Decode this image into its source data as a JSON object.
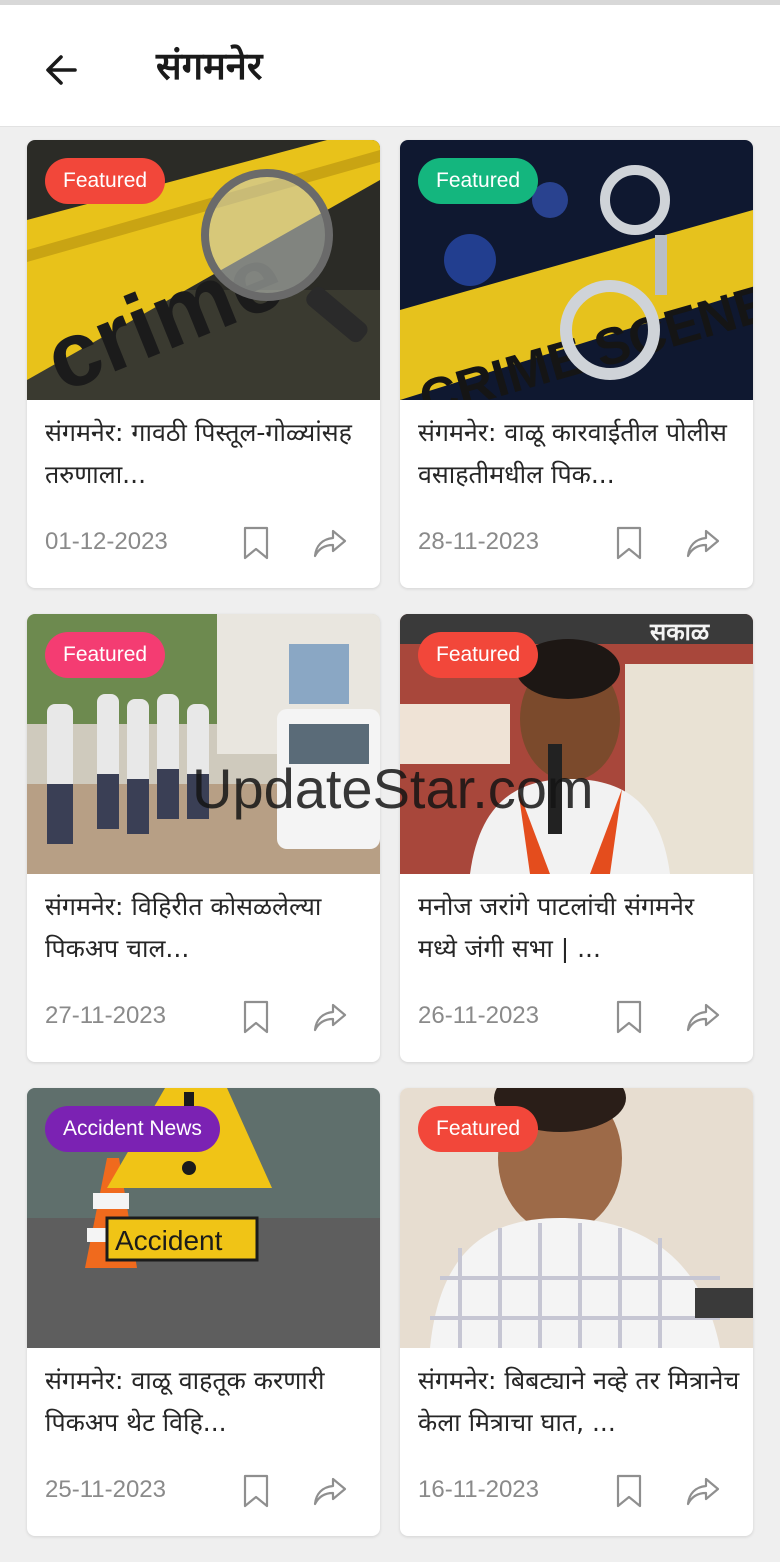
{
  "header": {
    "title": "संगमनेर"
  },
  "badge_colors": {
    "red": "#f2473a",
    "green": "#14b67e",
    "pink": "#f43c72",
    "purple": "#7b22b3"
  },
  "cards": [
    {
      "badge": "Featured",
      "badge_color": "#f2473a",
      "headline": "संगमनेर: गावठी पिस्तूल-गोळ्यांसह तरुणाला...",
      "date": "01-12-2023"
    },
    {
      "badge": "Featured",
      "badge_color": "#14b67e",
      "headline": "संगमनेर: वाळू कारवाईतील पोलीस वसाहतीमधील पिक...",
      "date": "28-11-2023"
    },
    {
      "badge": "Featured",
      "badge_color": "#f43c72",
      "headline": "संगमनेर: विहिरीत कोसळलेल्या पिकअप चाल...",
      "date": "27-11-2023"
    },
    {
      "badge": "Featured",
      "badge_color": "#f2473a",
      "headline": "मनोज जरांगे पाटलांची संगमनेर मध्ये जंगी सभा | ...",
      "date": "26-11-2023"
    },
    {
      "badge": "Accident News",
      "badge_color": "#7b22b3",
      "headline": "संगमनेर: वाळू वाहतूक करणारी पिकअप थेट विहि...",
      "date": "25-11-2023"
    },
    {
      "badge": "Featured",
      "badge_color": "#f2473a",
      "headline": "संगमनेर: बिबट्याने नव्हे तर मित्रानेच केला मित्राचा घात, ...",
      "date": "16-11-2023"
    }
  ],
  "images": {
    "card0": {
      "text": "crime"
    },
    "card1": {
      "text": "CRIME SCENE"
    },
    "card4": {
      "text": "Accident"
    },
    "card3": {
      "text": "सकाळ"
    }
  },
  "watermark": "UpdateStar.com"
}
